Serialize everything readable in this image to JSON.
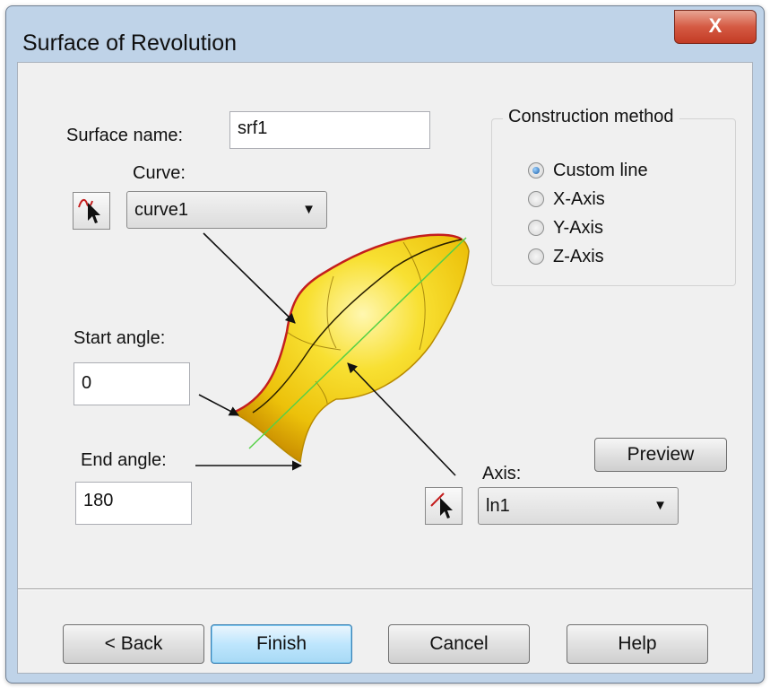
{
  "window": {
    "title": "Surface of Revolution",
    "close_label": "X"
  },
  "fields": {
    "surface_name_label": "Surface name:",
    "surface_name_value": "srf1",
    "curve_label": "Curve:",
    "curve_value": "curve1",
    "start_angle_label": "Start angle:",
    "start_angle_value": "0",
    "end_angle_label": "End angle:",
    "end_angle_value": "180",
    "axis_label": "Axis:",
    "axis_value": "ln1"
  },
  "construction": {
    "title": "Construction method",
    "options": [
      "Custom line",
      "X-Axis",
      "Y-Axis",
      "Z-Axis"
    ],
    "selected": "Custom line"
  },
  "buttons": {
    "preview": "Preview",
    "back": "< Back",
    "finish": "Finish",
    "cancel": "Cancel",
    "help": "Help"
  },
  "icons": {
    "pick_curve": "curve-pick-cursor-icon",
    "pick_axis": "line-pick-cursor-icon",
    "combo_arrow": "chevron-down-icon"
  },
  "colors": {
    "surface_fill": "#f5d214",
    "curve_red": "#c41e1e",
    "axis_green": "#56d046",
    "default_button": "#bee6fd"
  }
}
